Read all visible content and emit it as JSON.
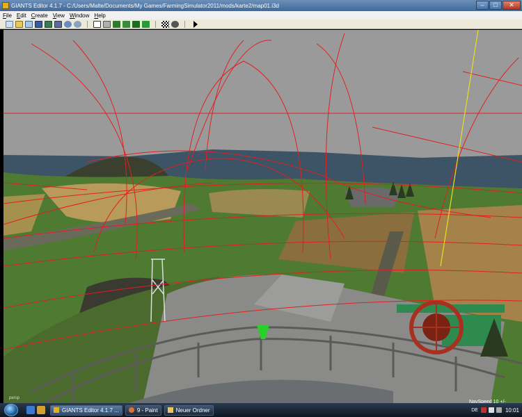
{
  "window": {
    "title": "GIANTS Editor 4.1.7 - C:/Users/Malte/Documents/My Games/FarmingSimulator2011/mods/karte2/map01.i3d",
    "minimize_glyph": "–",
    "maximize_glyph": "□",
    "close_glyph": "✕"
  },
  "menu": [
    {
      "key": "F",
      "rest": "ile"
    },
    {
      "key": "E",
      "rest": "dit"
    },
    {
      "key": "C",
      "rest": "reate"
    },
    {
      "key": "V",
      "rest": "iew"
    },
    {
      "key": "W",
      "rest": "indow"
    },
    {
      "key": "H",
      "rest": "elp"
    }
  ],
  "toolbar": {
    "group1": [
      "new-icon",
      "open-icon",
      "import-icon",
      "save-icon",
      "save-all-icon",
      "export-icon",
      "undo-icon",
      "redo-icon"
    ],
    "group2": [
      "select-icon",
      "move-icon",
      "terrain-paint-icon",
      "terrain-sculpt-icon",
      "foliage-paint-icon",
      "tree-paint-icon"
    ],
    "group3": [
      "checker-icon",
      "gear-icon"
    ],
    "play": "play-icon"
  },
  "viewport": {
    "camera_label": "persp",
    "nav_speed": "NavSpeed 10 +/-"
  },
  "taskbar": {
    "tasks": [
      {
        "label": "GIANTS Editor 4.1.7 ...",
        "icon": "giants-editor-icon",
        "active": true
      },
      {
        "label": "9 - Paint",
        "icon": "paint-icon",
        "active": false
      },
      {
        "label": "Neuer Ordner",
        "icon": "folder-icon",
        "active": false
      }
    ],
    "language": "DE",
    "clock": "10:01"
  },
  "colors": {
    "sky": "#9a9a9a",
    "sea": "#3d5366",
    "grass": "#4e7a32",
    "field": "#b89a5a",
    "wire": "#e02020",
    "guide_line": "#e8e020"
  }
}
